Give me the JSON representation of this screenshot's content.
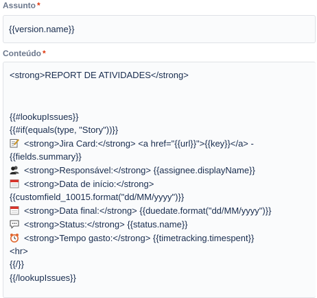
{
  "subject": {
    "label": "Assunto",
    "required_mark": "*",
    "value": "{{version.name}}"
  },
  "content": {
    "label": "Conteúdo",
    "required_mark": "*",
    "lines": [
      "<strong>REPORT DE ATIVIDADES</strong>",
      "{{#lookupIssues}}",
      "{{#if(equals(type, \"Story\"))}}",
      "<strong>Jira Card:</strong> <a href=\"{{url}}\">{{key}}</a> -",
      "{{fields.summary}}",
      "<strong>Responsável:</strong> {{assignee.displayName}}",
      "<strong>Data de início:</strong>",
      "{{customfield_10015.format(\"dd/MM/yyyy\")}}",
      "<strong>Data final:</strong> {{duedate.format(\"dd/MM/yyyy\")}}",
      "<strong>Status:</strong> {{status.name}}",
      "<strong>Tempo gasto:</strong> {{timetracking.timespent}}",
      "<hr>",
      "{{/}}",
      "{{/lookupIssues}}"
    ],
    "icons": {
      "jira_card": "memo-icon",
      "responsavel": "people-icon",
      "data_inicio": "calendar-icon",
      "data_final": "calendar-icon",
      "status": "speech-bubble-icon",
      "tempo_gasto": "alarm-clock-icon"
    }
  }
}
